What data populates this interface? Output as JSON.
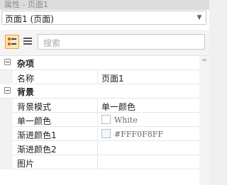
{
  "window": {
    "title": "属性 - 页面1"
  },
  "selector": {
    "value": "页面1 (页面)",
    "arrow_icon": "chevron-down-icon"
  },
  "toolbar": {
    "categorized_icon": "categorized-view-icon",
    "alphabetical_icon": "list-view-icon",
    "search_placeholder": "搜索"
  },
  "groups": {
    "misc": {
      "label": "杂项",
      "rows": [
        {
          "name": "名称",
          "value": "页面1"
        }
      ]
    },
    "background": {
      "label": "背景",
      "rows": [
        {
          "name": "背景模式",
          "value": "单一颜色"
        },
        {
          "name": "单一颜色",
          "value": "White"
        },
        {
          "name": "渐进颜色1",
          "value": "#FFF0F8FF"
        },
        {
          "name": "渐进颜色2",
          "value": ""
        },
        {
          "name": "图片",
          "value": ""
        }
      ]
    }
  },
  "colors": {
    "accent": "#fbe3b7",
    "accent_border": "#e7a44a"
  }
}
